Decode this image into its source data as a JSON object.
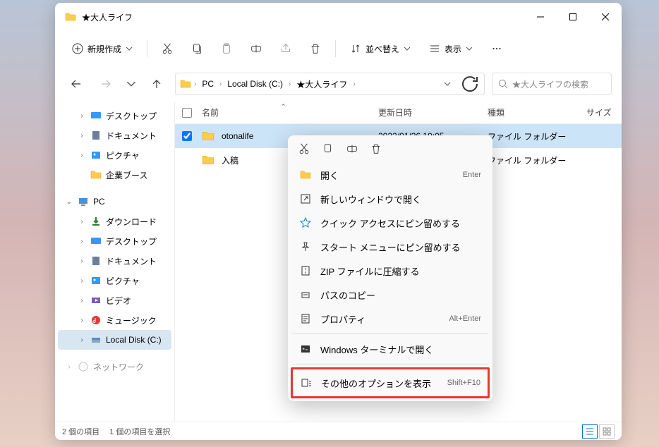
{
  "window": {
    "title": "★大人ライフ"
  },
  "toolbar": {
    "new_label": "新規作成",
    "sort_label": "並べ替え",
    "view_label": "表示"
  },
  "breadcrumb": {
    "pc": "PC",
    "disk": "Local Disk (C:)",
    "folder": "★大人ライフ"
  },
  "search": {
    "placeholder": "★大人ライフの検索"
  },
  "sidebar": {
    "desktop": "デスクトップ",
    "documents": "ドキュメント",
    "pictures": "ピクチャ",
    "business": "企業ブース",
    "pc": "PC",
    "downloads": "ダウンロード",
    "desktop2": "デスクトップ",
    "documents2": "ドキュメント",
    "pictures2": "ピクチャ",
    "videos": "ビデオ",
    "music": "ミュージック",
    "localdisk": "Local Disk (C:)",
    "network": "ネットワーク"
  },
  "columns": {
    "name": "名前",
    "date": "更新日時",
    "type": "種類",
    "size": "サイズ"
  },
  "rows": [
    {
      "name": "otonalife",
      "date": "2022/01/26 19:05",
      "type": "ファイル フォルダー",
      "selected": true
    },
    {
      "name": "入稿",
      "date": "",
      "type": "ファイル フォルダー",
      "selected": false
    }
  ],
  "context": {
    "open": "開く",
    "open_short": "Enter",
    "new_window": "新しいウィンドウで開く",
    "pin_quick": "クイック アクセスにピン留めする",
    "pin_start": "スタート メニューにピン留めする",
    "zip": "ZIP ファイルに圧縮する",
    "copy_path": "パスのコピー",
    "properties": "プロパティ",
    "properties_short": "Alt+Enter",
    "terminal": "Windows ターミナルで開く",
    "more": "その他のオプションを表示",
    "more_short": "Shift+F10"
  },
  "status": {
    "count": "2 個の項目",
    "selected": "1 個の項目を選択"
  }
}
